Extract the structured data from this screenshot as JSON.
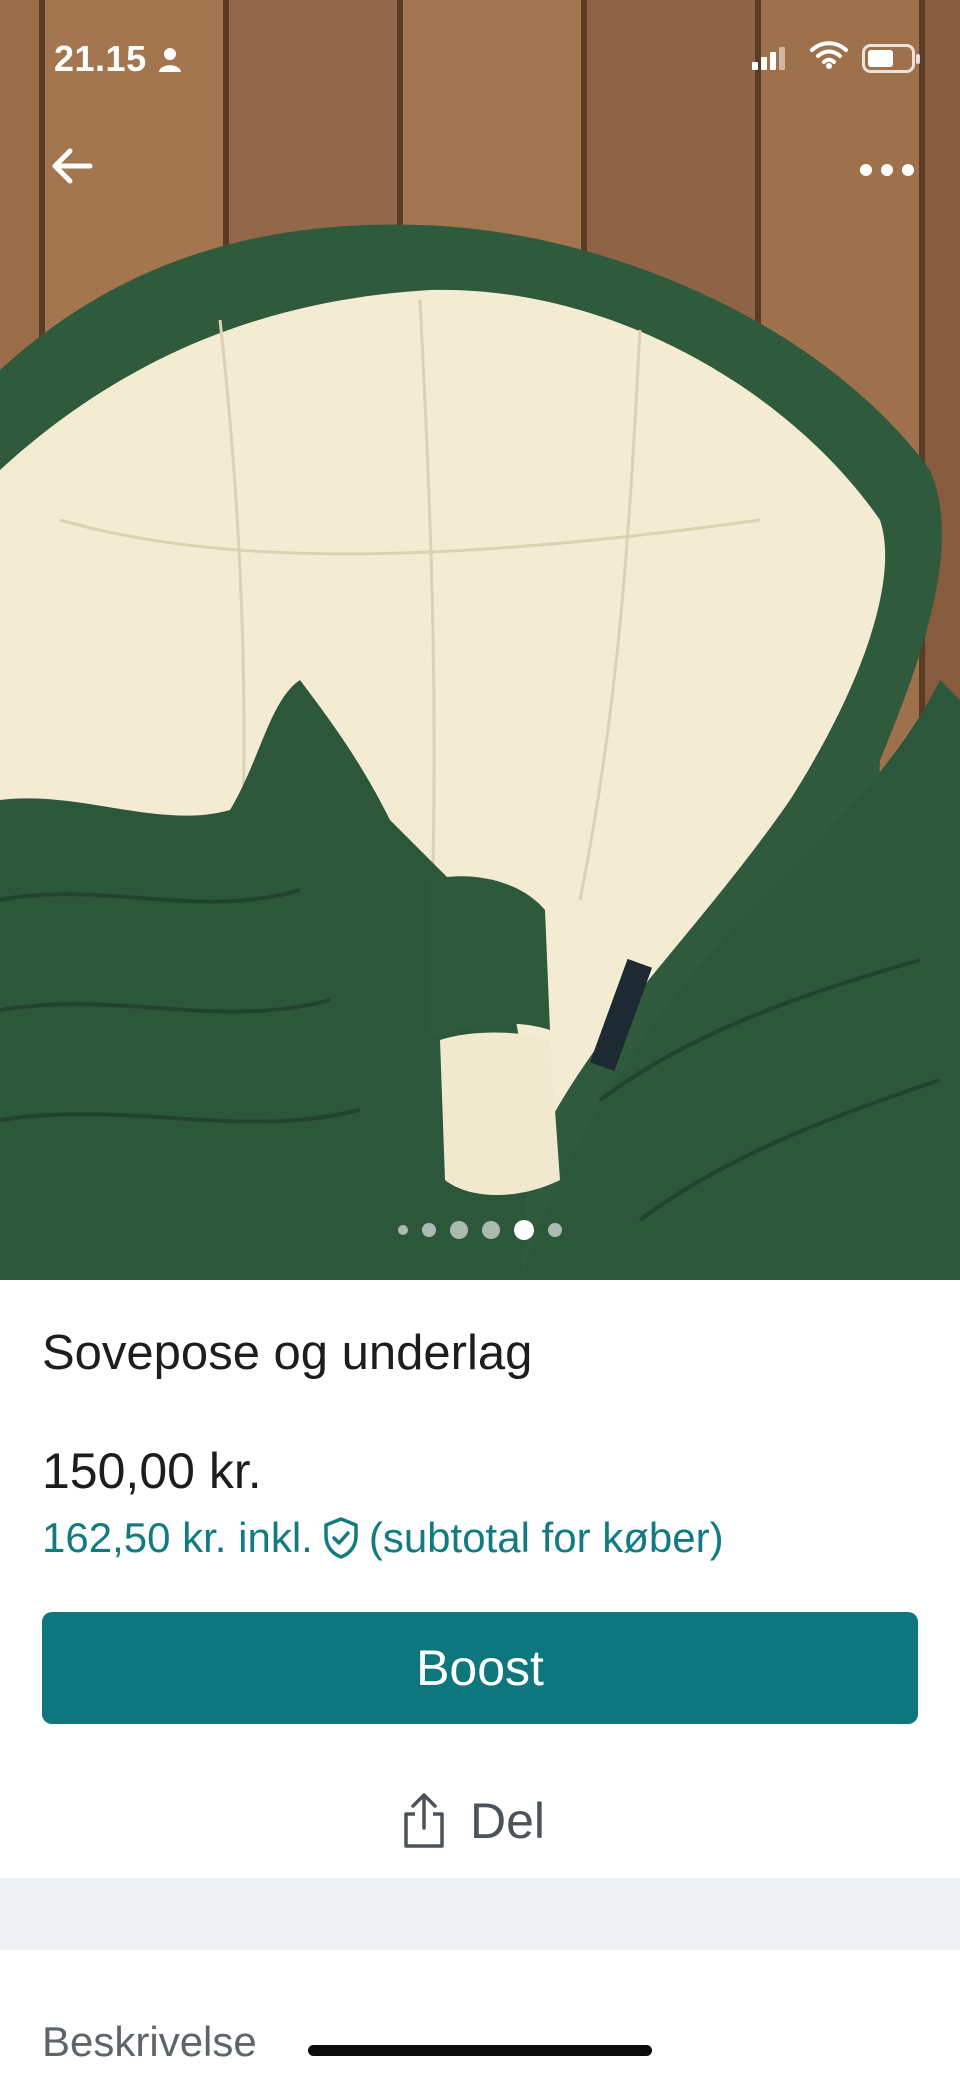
{
  "status_bar": {
    "time": "21.15"
  },
  "nav": {
    "back_icon": "arrow-left-icon",
    "more_icon": "more-horizontal-icon"
  },
  "gallery": {
    "image_count": 6,
    "active_index": 4
  },
  "listing": {
    "title": "Sovepose og underlag",
    "price": "150,00 kr.",
    "subtotal_price": "162,50 kr. inkl.",
    "subtotal_note": "(subtotal for køber)"
  },
  "actions": {
    "boost_label": "Boost",
    "share_label": "Del"
  },
  "description": {
    "section_label": "Beskrivelse"
  },
  "colors": {
    "accent": "#0e777d",
    "accent_text": "#127b82",
    "band": "#eef1f2"
  }
}
